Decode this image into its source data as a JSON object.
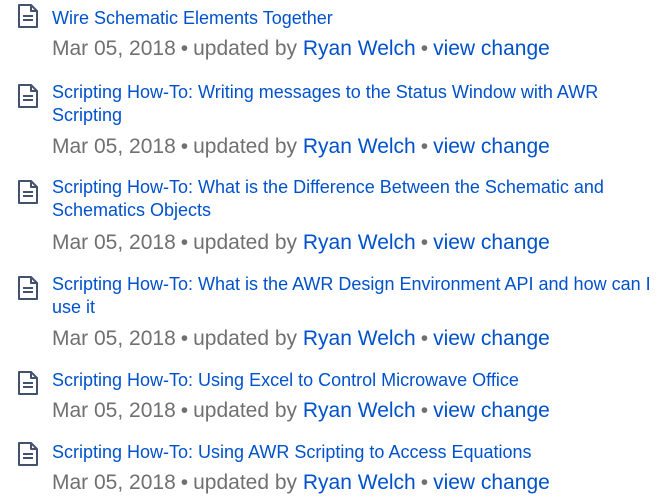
{
  "items": [
    {
      "icon": "page-icon",
      "title": "Wire Schematic Elements Together",
      "date": "Mar 05, 2018",
      "bullet": "•",
      "updated_by_label": "updated by",
      "author": "Ryan Welch",
      "view_change": "view change"
    },
    {
      "icon": "page-icon",
      "title": "Scripting How-To: Writing messages to the Status Window with AWR Scripting",
      "date": "Mar 05, 2018",
      "bullet": "•",
      "updated_by_label": "updated by",
      "author": "Ryan Welch",
      "view_change": "view change"
    },
    {
      "icon": "page-icon",
      "title": "Scripting How-To: What is the Difference Between the Schematic and Schematics Objects",
      "date": "Mar 05, 2018",
      "bullet": "•",
      "updated_by_label": "updated by",
      "author": "Ryan Welch",
      "view_change": "view change"
    },
    {
      "icon": "page-icon",
      "title": "Scripting How-To: What is the AWR Design Environment API and how can I use it",
      "date": "Mar 05, 2018",
      "bullet": "•",
      "updated_by_label": "updated by",
      "author": "Ryan Welch",
      "view_change": "view change"
    },
    {
      "icon": "page-icon",
      "title": "Scripting How-To: Using Excel to Control Microwave Office",
      "date": "Mar 05, 2018",
      "bullet": "•",
      "updated_by_label": "updated by",
      "author": "Ryan Welch",
      "view_change": "view change"
    },
    {
      "icon": "page-icon",
      "title": "Scripting How-To: Using AWR Scripting to Access Equations",
      "date": "Mar 05, 2018",
      "bullet": "•",
      "updated_by_label": "updated by",
      "author": "Ryan Welch",
      "view_change": "view change"
    }
  ],
  "colors": {
    "link": "#0052cc",
    "meta_text": "#707070",
    "icon_stroke": "#42526e"
  }
}
